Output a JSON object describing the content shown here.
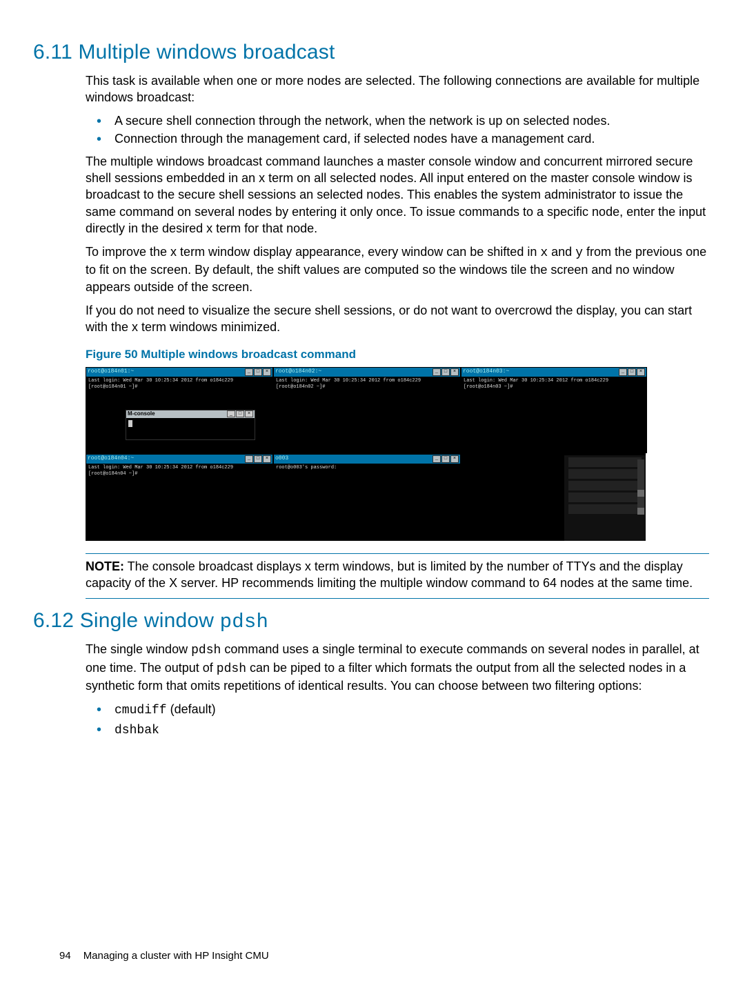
{
  "section611": {
    "heading": "6.11 Multiple windows broadcast",
    "p1": "This task is available when one or more nodes are selected. The following connections are available for multiple windows broadcast:",
    "bullets": [
      "A secure shell connection through the network, when the network is up on selected nodes.",
      "Connection through the management card, if selected nodes have a management card."
    ],
    "p2": "The multiple windows broadcast command launches a master console window and concurrent mirrored secure shell sessions embedded in an x term on all selected nodes. All input entered on the master console window is broadcast to the secure shell sessions an selected nodes. This enables the system administrator to issue the same command on several nodes by entering it only once. To issue commands to a specific node, enter the input directly in the desired x term for that node.",
    "p3a": "To improve the x term window display appearance, every window can be shifted in ",
    "p3_x": "x",
    "p3b": " and ",
    "p3_y": "y",
    "p3c": " from the previous one to fit on the screen. By default, the shift values are computed so the windows tile the screen and no window appears outside of the screen.",
    "p4": "If you do not need to visualize the secure shell sessions, or do not want to overcrowd the display, you can start with the x term windows minimized.",
    "figcap": "Figure 50 Multiple windows broadcast command",
    "term_titles": {
      "t1": "root@o184n01:~",
      "t2": "root@o184n02:~",
      "t3": "root@o184n03:~",
      "t4": "root@o184n04:~",
      "t5": "o003"
    },
    "term_body": {
      "line1": "Last login: Wed Mar 30 10:25:34 2012 from o184c229",
      "line2": "[root@o184n01 ~]# ",
      "line2b": "[root@o184n02 ~]# ",
      "line2c": "[root@o184n03 ~]# ",
      "line2d": "[root@o184n04 ~]# ",
      "pw": "root@o003's password: "
    },
    "mc_label": "M-console"
  },
  "note": {
    "label": "NOTE:",
    "text": "   The console broadcast displays x term windows, but is limited by the number of TTYs and the display capacity of the X server. HP recommends limiting the multiple window command to 64 nodes at the same time."
  },
  "section612": {
    "heading_prefix": "6.12 Single window ",
    "heading_mono": "pdsh",
    "p1a": "The single window ",
    "p1_mono1": "pdsh",
    "p1b": " command uses a single terminal to execute commands on several nodes in parallel, at one time. The output of ",
    "p1_mono2": "pdsh",
    "p1c": " can be piped to a filter which formats the output from all the selected nodes in a synthetic form that omits repetitions of identical results. You can choose between two filtering options:",
    "bullets": [
      {
        "mono": "cmudiff",
        "suffix": " (default)"
      },
      {
        "mono": "dshbak",
        "suffix": ""
      }
    ]
  },
  "footer": {
    "page": "94",
    "title": "Managing a cluster with HP Insight CMU"
  }
}
